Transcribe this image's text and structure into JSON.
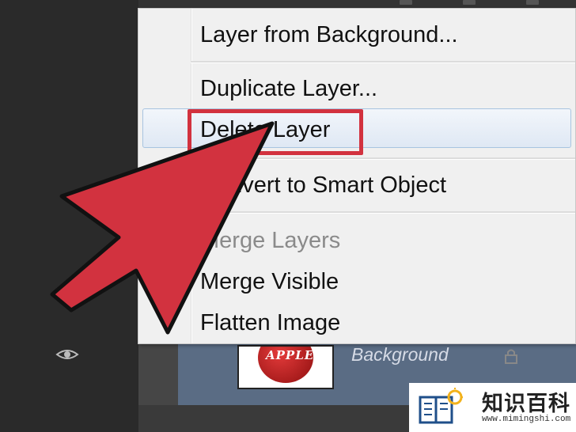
{
  "context_menu": {
    "items": [
      {
        "label": "Layer from Background...",
        "enabled": true
      },
      {
        "label": "Duplicate Layer...",
        "enabled": true
      },
      {
        "label": "Delete Layer",
        "enabled": true,
        "highlighted": true
      },
      {
        "label": "Convert to Smart Object",
        "enabled": true
      },
      {
        "label": "Merge Layers",
        "enabled": false
      },
      {
        "label": "Merge Visible",
        "enabled": true
      },
      {
        "label": "Flatten Image",
        "enabled": true
      }
    ]
  },
  "layers_panel": {
    "layer_name": "Background",
    "thumbnail_text": "APPLE",
    "icons": [
      "eye-icon",
      "lock-icon"
    ]
  },
  "annotation": {
    "arrow_color": "#d2323f",
    "highlight_color": "#d2323f"
  },
  "watermark": {
    "title": "知识百科",
    "url": "www.mimingshi.com"
  }
}
